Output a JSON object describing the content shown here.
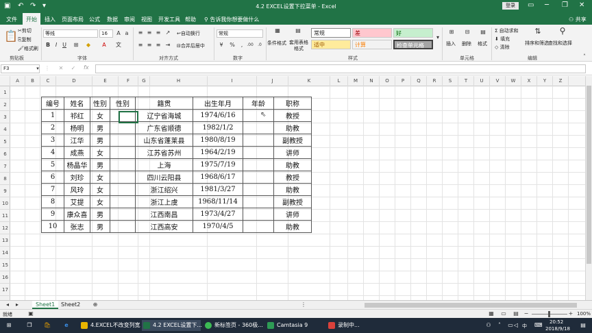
{
  "title_bar": {
    "title": "4.2 EXCEL设置下拉菜单 - Excel",
    "login": "登录"
  },
  "tabs": [
    "文件",
    "开始",
    "插入",
    "页面布局",
    "公式",
    "数据",
    "审阅",
    "视图",
    "开发工具",
    "帮助"
  ],
  "tell_me": "告诉我你想要做什么",
  "share": "共享",
  "ribbon": {
    "clipboard": {
      "cut": "剪切",
      "copy": "复制",
      "format_painter": "格式刷",
      "group": "剪贴板"
    },
    "font": {
      "name": "等线",
      "size": "16",
      "group": "字体"
    },
    "alignment": {
      "wrap": "自动换行",
      "merge": "合并后居中",
      "group": "对齐方式"
    },
    "number": {
      "format": "常规",
      "group": "数字"
    },
    "styles": {
      "conditional": "条件格式",
      "table": "套用表格格式",
      "cells": [
        "常规",
        "差",
        "好",
        "适中",
        "计算",
        "检查单元格"
      ],
      "group": "样式"
    },
    "cells": {
      "insert": "插入",
      "delete": "删除",
      "format": "格式",
      "group": "单元格"
    },
    "editing": {
      "autosum": "自动求和",
      "fill": "填充",
      "clear": "清除",
      "sort": "排序和筛选",
      "find": "查找和选择",
      "group": "编辑"
    }
  },
  "name_box": "F3",
  "fx": "fx",
  "columns": [
    "A",
    "B",
    "C",
    "D",
    "E",
    "F",
    "G",
    "H",
    "I",
    "J",
    "K",
    "L",
    "M",
    "N",
    "O",
    "P",
    "Q",
    "R",
    "S",
    "T",
    "U",
    "V",
    "W",
    "X",
    "Y",
    "Z"
  ],
  "rows": [
    "1",
    "2",
    "3",
    "4",
    "5",
    "6",
    "7",
    "8",
    "9",
    "10",
    "11",
    "12",
    "13",
    "14",
    "15",
    "16",
    "17"
  ],
  "table": {
    "headers": [
      "编号",
      "姓名",
      "性别",
      "性别",
      "籍贯",
      "出生年月",
      "年龄",
      "职称"
    ],
    "rows": [
      [
        "1",
        "祁红",
        "女",
        "",
        "辽宁省海城",
        "1974/6/16",
        "",
        "教授"
      ],
      [
        "2",
        "杨明",
        "男",
        "",
        "广东省顺德",
        "1982/1/2",
        "",
        "助教"
      ],
      [
        "3",
        "江华",
        "男",
        "",
        "山东省蓬莱县",
        "1980/8/19",
        "",
        "副教授"
      ],
      [
        "4",
        "成燕",
        "女",
        "",
        "江苏省苏州",
        "1964/2/19",
        "",
        "讲师"
      ],
      [
        "5",
        "杨晶华",
        "男",
        "",
        "上海",
        "1975/7/19",
        "",
        "助教"
      ],
      [
        "6",
        "刘珍",
        "女",
        "",
        "四川云阳县",
        "1968/6/17",
        "",
        "教授"
      ],
      [
        "7",
        "风玲",
        "女",
        "",
        "浙江绍兴",
        "1981/3/27",
        "",
        "助教"
      ],
      [
        "8",
        "艾提",
        "女",
        "",
        "浙江上虞",
        "1968/11/14",
        "",
        "副教授"
      ],
      [
        "9",
        "康众喜",
        "男",
        "",
        "江西南昌",
        "1973/4/27",
        "",
        "讲师"
      ],
      [
        "10",
        "张志",
        "男",
        "",
        "江西高安",
        "1970/4/5",
        "",
        "助教"
      ]
    ]
  },
  "sheets": [
    "Sheet1",
    "Sheet2"
  ],
  "status": {
    "left": "就绪",
    "zoom": "100%"
  },
  "taskbar": {
    "items": [
      "4.EXCEL不改变列宽",
      "4.2 EXCEL设置下...",
      "新标签页 - 360极...",
      "Camtasia 9",
      "录制中..."
    ],
    "time": "20:52",
    "date": "2018/9/18",
    "ime": "中"
  },
  "colors": {
    "excel_green": "#217346",
    "bad": "#ffc7ce",
    "good": "#c6efce",
    "neutral": "#ffeb9c"
  }
}
